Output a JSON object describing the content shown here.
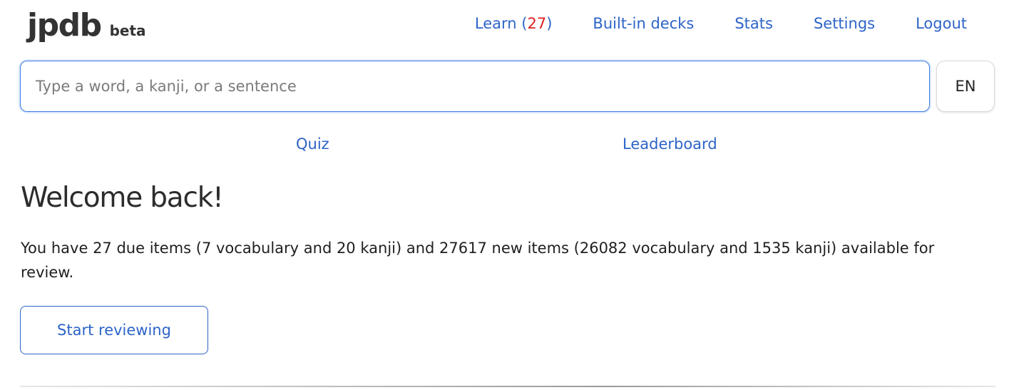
{
  "header": {
    "logo": "jpdb",
    "logo_badge": "beta",
    "nav": {
      "learn_label": "Learn",
      "learn_open": " (",
      "learn_count": "27",
      "learn_close": ")",
      "builtin_decks": "Built-in decks",
      "stats": "Stats",
      "settings": "Settings",
      "logout": "Logout"
    }
  },
  "search": {
    "placeholder": "Type a word, a kanji, or a sentence",
    "value": "",
    "language_button": "EN"
  },
  "sub_nav": {
    "quiz": "Quiz",
    "leaderboard": "Leaderboard"
  },
  "main": {
    "heading": "Welcome back!",
    "summary": "You have 27 due items (7 vocabulary and 20 kanji) and 27617 new items (26082 vocabulary and 1535 kanji) available for review.",
    "start_button": "Start reviewing"
  },
  "colors": {
    "link": "#2d64c8",
    "due_count": "#e02020",
    "input_focus_border": "#3a7be0",
    "text": "#2a2a2a"
  }
}
